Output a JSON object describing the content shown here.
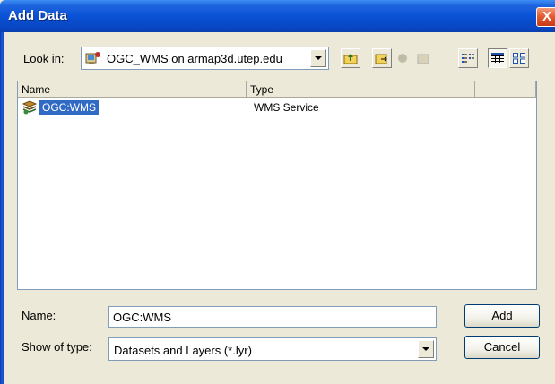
{
  "window": {
    "title": "Add Data",
    "close_glyph": "X"
  },
  "look_in": {
    "label": "Look in:",
    "value": "OGC_WMS on armap3d.utep.edu",
    "icon": "server-connection-icon"
  },
  "toolbar": {
    "buttons": [
      "up-one-level-icon",
      "connect-folder-icon",
      "disconnect-folder-icon",
      "new-folder-icon",
      "list-view-icon",
      "details-view-icon",
      "thumbnails-view-icon"
    ]
  },
  "file_list": {
    "columns": [
      "Name",
      "Type"
    ],
    "rows": [
      {
        "name": "OGC:WMS",
        "type": "WMS Service",
        "icon": "wms-service-icon",
        "selected": true
      }
    ]
  },
  "name_field": {
    "label": "Name:",
    "value": "OGC:WMS"
  },
  "type_field": {
    "label": "Show of type:",
    "value": "Datasets and Layers (*.lyr)"
  },
  "buttons": {
    "add": "Add",
    "cancel": "Cancel"
  },
  "colors": {
    "selection": "#316ac5",
    "titlebar": "#0a52d6",
    "dialog_bg": "#ece9d8"
  }
}
